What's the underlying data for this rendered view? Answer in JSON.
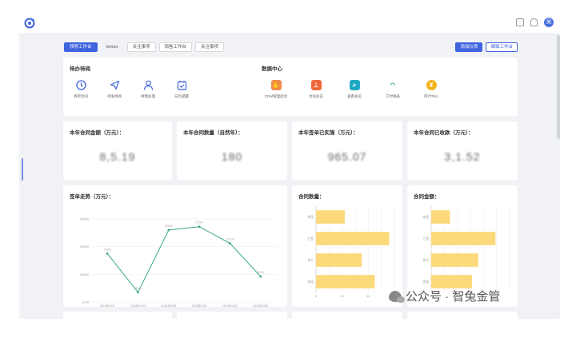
{
  "header": {
    "avatar_text": "吴"
  },
  "tabs": [
    {
      "label": "领导工作台",
      "active": true
    },
    {
      "label": "lemon",
      "active": false,
      "plain": true
    },
    {
      "label": "关注事项",
      "active": false
    },
    {
      "label": "销售工作台",
      "active": false
    },
    {
      "label": "关注事项",
      "active": false
    }
  ],
  "actions": {
    "add": "添加仪表",
    "edit": "编辑工作台"
  },
  "todo": {
    "title": "待办待阅",
    "items": [
      {
        "label": "待审合同",
        "icon": "clock-icon"
      },
      {
        "label": "待发待阅",
        "icon": "send-icon"
      },
      {
        "label": "待我处理",
        "icon": "person-icon"
      },
      {
        "label": "日历提醒",
        "icon": "calendar-icon"
      }
    ]
  },
  "data_center": {
    "title": "数据中心",
    "items": [
      {
        "label": "CRM管理后台",
        "icon": "handshake-icon",
        "color": "#f08a4b"
      },
      {
        "label": "合同总览",
        "icon": "stamp-icon",
        "color": "#f0673a"
      },
      {
        "label": "查看总览",
        "icon": "search-icon",
        "color": "#20a9c4"
      },
      {
        "label": "工时填表",
        "icon": "wifi-icon",
        "color": "#2fb56a"
      },
      {
        "label": "审计中心",
        "icon": "yen-icon",
        "color": "#f2b21b"
      }
    ]
  },
  "stats": [
    {
      "title": "本年合同金额（万元）：",
      "value": "8,5.19"
    },
    {
      "title": "本年合同数量（自然年）：",
      "value": "180"
    },
    {
      "title": "本年签单已实施（万元）：",
      "value": "965.07"
    },
    {
      "title": "本年合同已收款（万元）：",
      "value": "3,1.52"
    }
  ],
  "line_chart_title": "签单走势（万元）：",
  "bar1_title": "合同数量：",
  "bar2_title": "合同金额：",
  "watermark": "公众号 · 智兔金管",
  "chart_data": [
    {
      "type": "line",
      "title": "签单走势（万元）：",
      "x": [
        "2023年01月",
        "2023年02月",
        "2023年03月",
        "2023年04月",
        "2023年05月",
        "2023年06月"
      ],
      "values": [
        17500,
        3500,
        26000,
        27200,
        21200,
        9200
      ],
      "y_ticks": [
        "0.00",
        "10000",
        "20000",
        "30000"
      ],
      "ylim": [
        0,
        30000
      ],
      "color": "#3aa890"
    },
    {
      "type": "bar",
      "orientation": "horizontal",
      "title": "合同数量：",
      "categories": [
        "待签",
        "已签",
        "执行",
        "完成"
      ],
      "values": [
        22,
        56,
        35,
        45
      ],
      "x_ticks": [
        "0",
        "20",
        "40",
        "60"
      ],
      "xlim": [
        0,
        60
      ],
      "color": "#fcd97a"
    },
    {
      "type": "bar",
      "orientation": "horizontal",
      "title": "合同金额：",
      "categories": [
        "待签",
        "已签",
        "执行",
        "完成"
      ],
      "values": [
        12,
        41,
        30,
        26
      ],
      "x_ticks": [],
      "xlim": [
        0,
        50
      ],
      "color": "#fcd97a"
    }
  ]
}
